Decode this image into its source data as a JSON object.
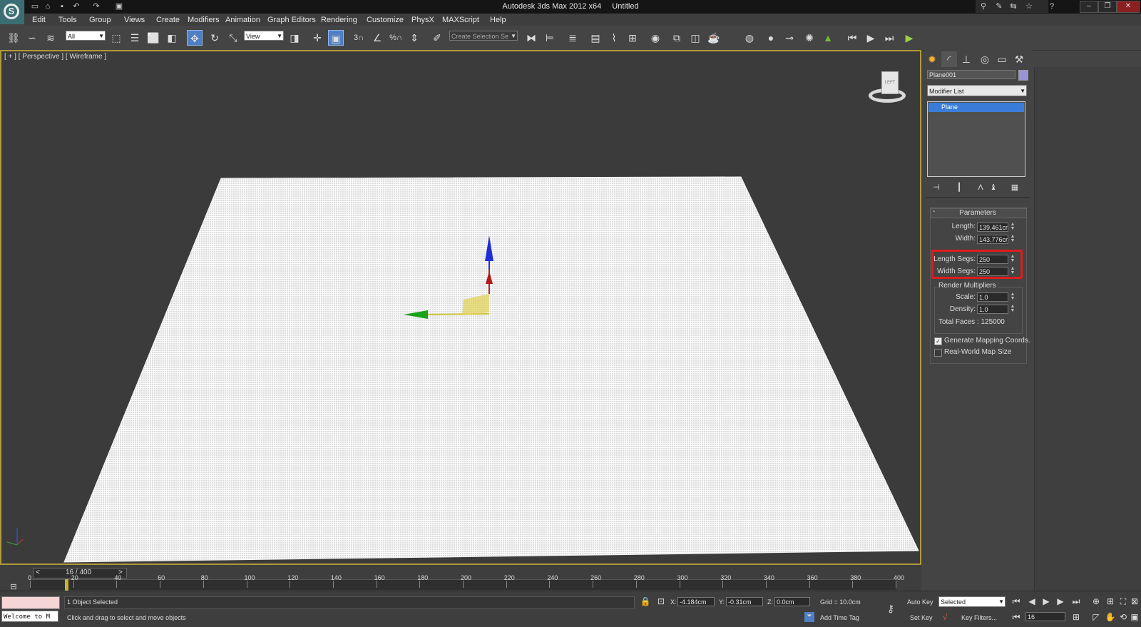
{
  "app": {
    "title": "Autodesk 3ds Max  2012 x64",
    "document": "Untitled"
  },
  "menu": [
    "Edit",
    "Tools",
    "Group",
    "Views",
    "Create",
    "Modifiers",
    "Animation",
    "Graph Editors",
    "Rendering",
    "Customize",
    "PhysX",
    "MAXScript",
    "Help"
  ],
  "toolbar": {
    "selection_filter": "All",
    "ref_coord": "View",
    "named_selection_placeholder": "Create Selection Se",
    "snap_labels": [
      "3",
      "%"
    ]
  },
  "viewport": {
    "label": "[ + ] [ Perspective ] [ Wireframe ]",
    "viewcube_face": "LEFT"
  },
  "command_panel": {
    "object_name": "Plane001",
    "object_color": "#9a93d8",
    "modifier_list": "Modifier List",
    "stack_items": [
      "Plane"
    ],
    "rollout_title": "Parameters",
    "params": [
      {
        "label": "Length:",
        "value": "139.461cr"
      },
      {
        "label": "Width:",
        "value": "143.776cr"
      }
    ],
    "segs": [
      {
        "label": "Length Segs:",
        "value": "250"
      },
      {
        "label": "Width Segs:",
        "value": "250"
      }
    ],
    "render_multipliers_title": "Render Multipliers",
    "multipliers": [
      {
        "label": "Scale:",
        "value": "1.0"
      },
      {
        "label": "Density:",
        "value": "1.0"
      }
    ],
    "total_faces": "Total Faces : 125000",
    "checkboxes": [
      {
        "label": "Generate Mapping Coords.",
        "checked": true
      },
      {
        "label": "Real-World Map Size",
        "checked": false
      }
    ],
    "highlight_color": "#e01b1b"
  },
  "timeline": {
    "frame_label": "16 / 400",
    "ticks": [
      "0",
      "20",
      "40",
      "60",
      "80",
      "100",
      "120",
      "140",
      "160",
      "180",
      "200",
      "220",
      "240",
      "260",
      "280",
      "300",
      "320",
      "340",
      "360",
      "380",
      "400"
    ],
    "current_frame_fraction": 0.04
  },
  "status": {
    "script_listener": "Welcome to M",
    "selection": "1 Object Selected",
    "prompt": "Click and drag to select and move objects",
    "x_label": "X:",
    "x_value": "-4.184cm",
    "y_label": "Y:",
    "y_value": "-0.31cm",
    "z_label": "Z:",
    "z_value": "0.0cm",
    "grid": "Grid = 10.0cm",
    "add_time_tag": "Add Time Tag",
    "auto_key": "Auto Key",
    "set_key": "Set Key",
    "key_mode": "Selected",
    "key_filters": "Key Filters...",
    "current_frame": "16"
  }
}
